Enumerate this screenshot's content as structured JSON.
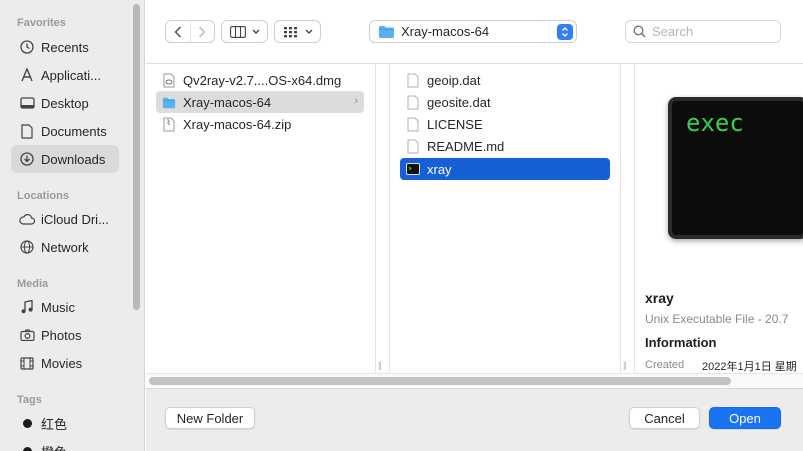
{
  "sidebar": {
    "favorites_header": "Favorites",
    "locations_header": "Locations",
    "media_header": "Media",
    "tags_header": "Tags",
    "favorites": [
      {
        "label": "Recents",
        "icon": "clock-icon"
      },
      {
        "label": "Applicati...",
        "icon": "applications-icon"
      },
      {
        "label": "Desktop",
        "icon": "desktop-icon"
      },
      {
        "label": "Documents",
        "icon": "document-icon"
      },
      {
        "label": "Downloads",
        "icon": "download-icon",
        "selected": true
      }
    ],
    "locations": [
      {
        "label": "iCloud Dri...",
        "icon": "cloud-icon"
      },
      {
        "label": "Network",
        "icon": "globe-icon"
      }
    ],
    "media": [
      {
        "label": "Music",
        "icon": "music-note-icon"
      },
      {
        "label": "Photos",
        "icon": "camera-icon"
      },
      {
        "label": "Movies",
        "icon": "film-icon"
      }
    ],
    "tags": [
      {
        "label": "红色",
        "color": "#1a1a1a"
      },
      {
        "label": "橙色",
        "color": "#1a1a1a"
      }
    ]
  },
  "toolbar": {
    "path_label": "Xray-macos-64",
    "search_placeholder": "Search"
  },
  "columns": {
    "col1": [
      {
        "label": "Qv2ray-v2.7....OS-x64.dmg",
        "icon": "disk-image-icon"
      },
      {
        "label": "Xray-macos-64",
        "icon": "folder-icon",
        "selected": true
      },
      {
        "label": "Xray-macos-64.zip",
        "icon": "zip-file-icon"
      }
    ],
    "col2": [
      {
        "label": "geoip.dat",
        "icon": "file-icon"
      },
      {
        "label": "geosite.dat",
        "icon": "file-icon"
      },
      {
        "label": "LICENSE",
        "icon": "file-icon"
      },
      {
        "label": "README.md",
        "icon": "file-icon"
      },
      {
        "label": "xray",
        "icon": "terminal-icon",
        "selected": true
      }
    ]
  },
  "preview": {
    "thumb_text": "exec",
    "name": "xray",
    "kind": "Unix Executable File - 20.7",
    "info_header": "Information",
    "created_label": "Created",
    "created_value": "2022年1月1日 星期"
  },
  "buttons": {
    "new_folder": "New Folder",
    "cancel": "Cancel",
    "open": "Open"
  },
  "colors": {
    "accent": "#1a73f0",
    "selection_blue": "#1560d4",
    "folder_blue": "#5ab0f0"
  }
}
